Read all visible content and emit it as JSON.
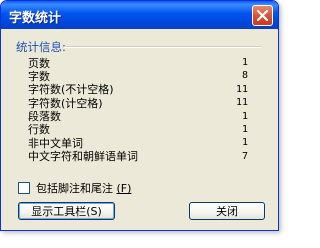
{
  "window": {
    "title": "字数统计",
    "close_icon": "close-icon",
    "accent_color": "#0053ee",
    "close_color": "#dc5236"
  },
  "section": {
    "label": "统计信息:"
  },
  "stats": [
    {
      "label": "页数",
      "value": "1"
    },
    {
      "label": "字数",
      "value": "8"
    },
    {
      "label": "字符数(不计空格)",
      "value": "11"
    },
    {
      "label": "字符数(计空格)",
      "value": "11"
    },
    {
      "label": "段落数",
      "value": "1"
    },
    {
      "label": "行数",
      "value": "1"
    },
    {
      "label": "非中文单词",
      "value": "1"
    },
    {
      "label": "中文字符和朝鲜语单词",
      "value": "7"
    }
  ],
  "checkbox": {
    "label": "包括脚注和尾注",
    "hotkey": "(F)",
    "checked": false
  },
  "buttons": {
    "show_toolbar": "显示工具栏(S)",
    "close": "关闭"
  }
}
